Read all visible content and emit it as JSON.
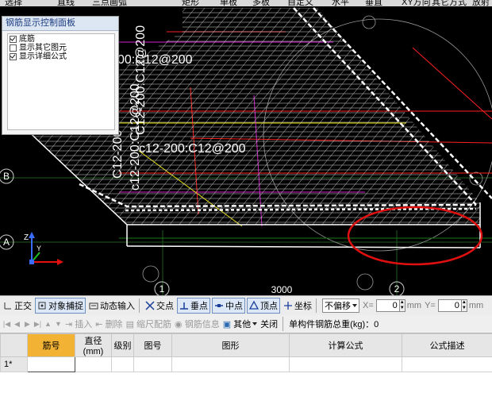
{
  "top_toolbar": {
    "select_label": "选择",
    "line_label": "直线",
    "three_point_arc_label": "三点画弧",
    "rectangle_label": "矩形",
    "single_board_label": "单板",
    "multi_board_label": "多板",
    "custom_label": "自定义",
    "horizontal_label": "水平",
    "vertical_label": "垂直",
    "xy_direction_label": "XY方向",
    "other_method_label": "其它方式",
    "radial_label": "放射"
  },
  "rebar_panel": {
    "title": "钢筋显示控制面板",
    "items": [
      {
        "label": "底筋",
        "checked": true
      },
      {
        "label": "显示其它图元",
        "checked": false
      },
      {
        "label": "显示详细公式",
        "checked": true
      }
    ]
  },
  "viewport": {
    "labels": {
      "rebar_label_top": "00:C12@200",
      "rebar_label_vertical_a": "C12-200:C12@200",
      "rebar_label_main": "c12-200:C12@200",
      "rebar_label_vertical_b": "C12-200",
      "rebar_label_vertical_c": "c12-200:C12@200"
    },
    "axis_labels": {
      "row_b": "B",
      "row_a": "A",
      "col_1": "1",
      "col_2": "2",
      "dimension": "3000"
    },
    "axis_gizmo": {
      "z": "Z",
      "y": "Y"
    },
    "colors": {
      "background": "#000000",
      "slab_mesh": "#ffffff",
      "rebar_red": "#ff2020",
      "rebar_magenta": "#d020d0",
      "beam_yellow": "#e8e000",
      "annotation_circle": "#e01010",
      "axis_line": "#1a7a1a"
    }
  },
  "snap_bar": {
    "ortho_label": "正交",
    "object_snap_label": "对象捕捉",
    "dynamic_input_label": "动态输入",
    "intersection_label": "交点",
    "perpendicular_label": "垂点",
    "midpoint_label": "中点",
    "vertex_label": "顶点",
    "coordinate_label": "坐标",
    "offset_mode": "不偏移",
    "x_label": "X=",
    "x_value": "0",
    "unit": "mm",
    "y_label": "Y=",
    "y_value": "0",
    "unit2": "mm"
  },
  "rebar_toolbar": {
    "insert_label": "插入",
    "delete_label": "删除",
    "scale_rebar_label": "缩尺配筋",
    "rebar_info_label": "钢筋信息",
    "other_label": "其他",
    "close_label": "关闭",
    "total_weight_label": "单构件钢筋总重(kg)：0"
  },
  "rebar_table": {
    "columns": [
      "",
      "筋号",
      "直径(mm)",
      "级别",
      "图号",
      "图形",
      "计算公式",
      "公式描述"
    ],
    "rows": [
      {
        "index": "1*",
        "cells": [
          "",
          "",
          "",
          "",
          "",
          "",
          ""
        ]
      }
    ]
  }
}
